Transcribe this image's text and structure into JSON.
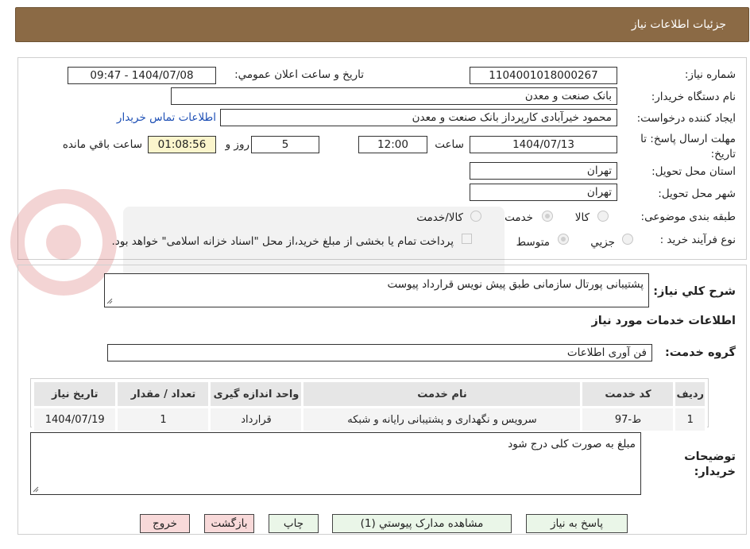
{
  "header": {
    "title": "جزئیات اطلاعات نیاز"
  },
  "fields": {
    "need_number_label": "شماره نیاز:",
    "need_number": "1104001018000267",
    "announce_label": "تاریخ و ساعت اعلان عمومي:",
    "announce_value": "1404/07/08 - 09:47",
    "buyer_org_label": "نام دستگاه خریدار:",
    "buyer_org": "بانک صنعت و معدن",
    "creator_label": "ایجاد کننده درخواست:",
    "creator": "محمود خیرآبادی کارپرداز بانک صنعت و معدن",
    "contact_link": "اطلاعات تماس خریدار",
    "deadline_label": "مهلت ارسال پاسخ: تا تاریخ:",
    "deadline_date": "1404/07/13",
    "time_word": "ساعت",
    "deadline_time": "12:00",
    "days": "5",
    "days_word": "روز و",
    "remaining": "01:08:56",
    "remaining_label": "ساعت باقي مانده",
    "province_label": "استان محل تحویل:",
    "province": "تهران",
    "city_label": "شهر محل تحویل:",
    "city": "تهران",
    "category_label": "طبقه بندی موضوعی:",
    "category_options": [
      "کالا",
      "خدمت",
      "کالا/خدمت"
    ],
    "category_selected": "خدمت",
    "process_label": "نوع فرآیند خرید :",
    "process_options": [
      "جزيي",
      "متوسط"
    ],
    "process_selected": "متوسط",
    "payment_note": "پرداخت تمام یا بخشی از مبلغ خرید،از محل \"اسناد خزانه اسلامی\" خواهد بود."
  },
  "description": {
    "label": "شرح کلي نياز:",
    "value": "پشتیبانی پورتال سازمانی طبق پیش نویس قرارداد پیوست"
  },
  "services": {
    "section_title": "اطلاعات خدمات مورد نیاز",
    "group_label": "گروه خدمت:",
    "group_value": "فن آوری اطلاعات",
    "columns": [
      "ردیف",
      "کد خدمت",
      "نام خدمت",
      "واحد اندازه گیری",
      "تعداد / مقدار",
      "تاریخ نیاز"
    ],
    "rows": [
      [
        "1",
        "ط-97",
        "سرویس و نگهداری و پشتیبانی رایانه و شبکه",
        "قرارداد",
        "1",
        "1404/07/19"
      ]
    ]
  },
  "buyer_notes": {
    "label": "توضیحات خریدار:",
    "value": "مبلغ به صورت کلی درج شود"
  },
  "buttons": {
    "reply": "پاسخ به نیاز",
    "attachments": "مشاهده مدارک پیوستي (1)",
    "print": "چاپ",
    "back": "بازگشت",
    "exit": "خروج"
  },
  "colors": {
    "header_bg": "#8b6a45",
    "button_bg": "#eaf6e8",
    "button_red_bg": "#f8d9d9",
    "timer_bg": "#fbf5cc",
    "link": "#1d4fb5"
  }
}
